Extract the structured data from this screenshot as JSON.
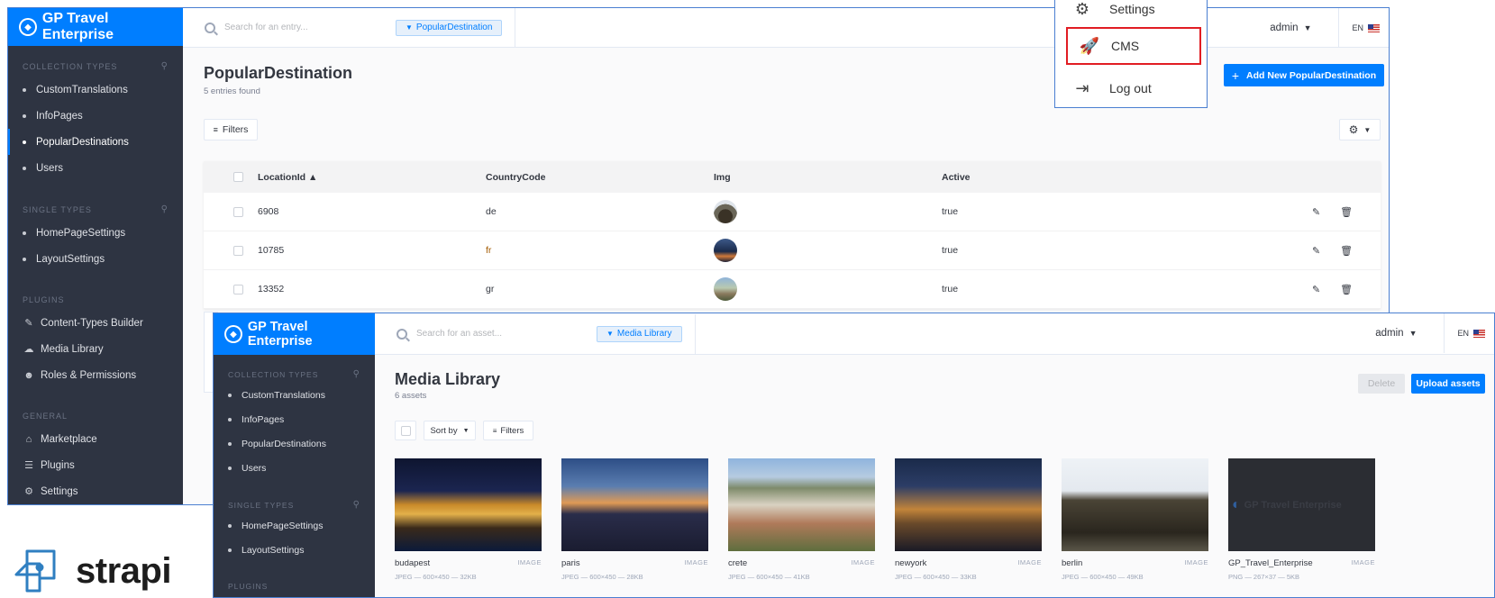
{
  "strapi_wordmark": "strapi",
  "brand_color": "#007eff",
  "content_manager": {
    "app_name": "GP Travel Enterprise",
    "search_placeholder": "Search for an entry...",
    "chip_label": "PopularDestination",
    "admin_label": "admin",
    "lang": "EN",
    "sidebar": {
      "collection_title": "COLLECTION TYPES",
      "collection_items": [
        "CustomTranslations",
        "InfoPages",
        "PopularDestinations",
        "Users"
      ],
      "single_title": "SINGLE TYPES",
      "single_items": [
        "HomePageSettings",
        "LayoutSettings"
      ],
      "plugins_title": "PLUGINS",
      "plugin_items": [
        "Content-Types Builder",
        "Media Library",
        "Roles & Permissions"
      ],
      "general_title": "GENERAL",
      "general_items": [
        "Marketplace",
        "Plugins",
        "Settings"
      ]
    },
    "page_title": "PopularDestination",
    "entries_found": "5 entries found",
    "add_button": "Add New PopularDestination",
    "filters_label": "Filters",
    "columns": [
      "LocationId ▲",
      "CountryCode",
      "Img",
      "Active"
    ],
    "rows": [
      {
        "id": "6908",
        "code": "de",
        "active": "true",
        "thumb_icon": "brandenburg-gate-thumbnail"
      },
      {
        "id": "10785",
        "code": "fr",
        "active": "true",
        "thumb_icon": "paris-night-thumbnail"
      },
      {
        "id": "13352",
        "code": "gr",
        "active": "true",
        "thumb_icon": "crete-town-thumbnail"
      }
    ],
    "dropdown_menu": {
      "items": [
        {
          "label": "Settings",
          "icon": "gear-icon"
        },
        {
          "label": "CMS",
          "icon": "rocket-icon",
          "highlighted": true
        },
        {
          "label": "Log out",
          "icon": "logout-icon"
        }
      ]
    }
  },
  "media_library": {
    "app_name": "GP Travel Enterprise",
    "search_placeholder": "Search for an asset...",
    "chip_label": "Media Library",
    "admin_label": "admin",
    "lang": "EN",
    "sidebar": {
      "collection_title": "COLLECTION TYPES",
      "collection_items": [
        "CustomTranslations",
        "InfoPages",
        "PopularDestinations",
        "Users"
      ],
      "single_title": "SINGLE TYPES",
      "single_items": [
        "HomePageSettings",
        "LayoutSettings"
      ],
      "plugins_title": "PLUGINS"
    },
    "page_title": "Media Library",
    "asset_count": "6 assets",
    "delete_button": "Delete",
    "upload_button": "Upload assets",
    "sort_label": "Sort by",
    "filters_label": "Filters",
    "assets": [
      {
        "name": "budapest",
        "type": "IMAGE",
        "meta": "JPEG — 600×450 — 32KB"
      },
      {
        "name": "paris",
        "type": "IMAGE",
        "meta": "JPEG — 600×450 — 28KB"
      },
      {
        "name": "crete",
        "type": "IMAGE",
        "meta": "JPEG — 600×450 — 41KB"
      },
      {
        "name": "newyork",
        "type": "IMAGE",
        "meta": "JPEG — 600×450 — 33KB"
      },
      {
        "name": "berlin",
        "type": "IMAGE",
        "meta": "JPEG — 600×450 — 49KB"
      },
      {
        "name": "GP_Travel_Enterprise",
        "type": "IMAGE",
        "meta": "PNG — 267×37 — 5KB",
        "logo_text": "GP Travel Enterprise"
      }
    ]
  }
}
